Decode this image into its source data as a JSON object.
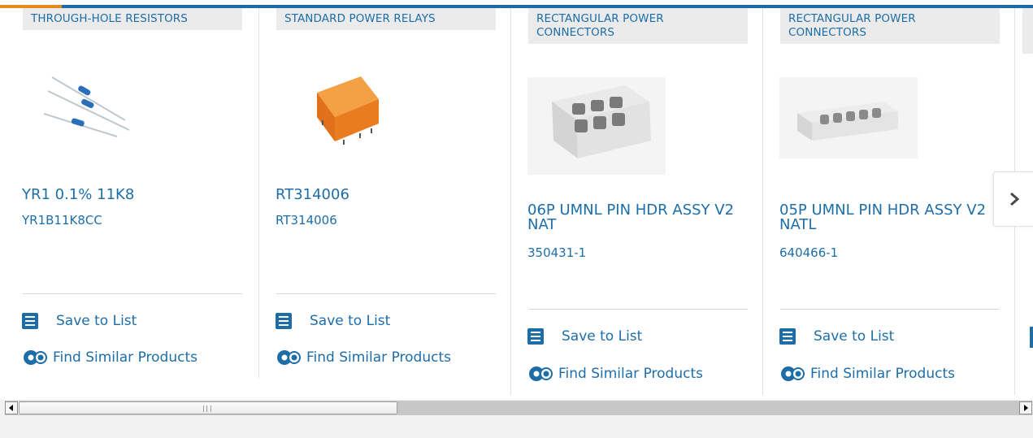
{
  "products": [
    {
      "category": "THROUGH-HOLE RESISTORS",
      "title": "YR1 0.1% 11K8",
      "part_number": "YR1B11K8CC",
      "image": "resistors-image",
      "save_label": "Save to List",
      "similar_label": "Find Similar Products"
    },
    {
      "category": "STANDARD POWER RELAYS",
      "title": "RT314006",
      "part_number": "RT314006",
      "image": "relay-image",
      "save_label": "Save to List",
      "similar_label": "Find Similar Products"
    },
    {
      "category": "RECTANGULAR POWER CONNECTORS",
      "title": "06P UMNL PIN HDR ASSY V2 NAT",
      "part_number": "350431-1",
      "image": "connector-6pin-image",
      "save_label": "Save to List",
      "similar_label": "Find Similar Products"
    },
    {
      "category": "RECTANGULAR POWER CONNECTORS",
      "title": "05P UMNL PIN HDR ASSY V2 NATL",
      "part_number": "640466-1",
      "image": "connector-5pin-image",
      "save_label": "Save to List",
      "similar_label": "Find Similar Products"
    }
  ],
  "carousel": {
    "next_icon": "chevron-right-icon"
  },
  "colors": {
    "link": "#1d6ea8",
    "accent_bar": "#1c6aa8",
    "accent_orange": "#e8891e",
    "category_bg": "#ebebeb"
  },
  "scrollbar": {
    "left_icon": "arrow-left-icon",
    "right_icon": "arrow-right-icon"
  }
}
